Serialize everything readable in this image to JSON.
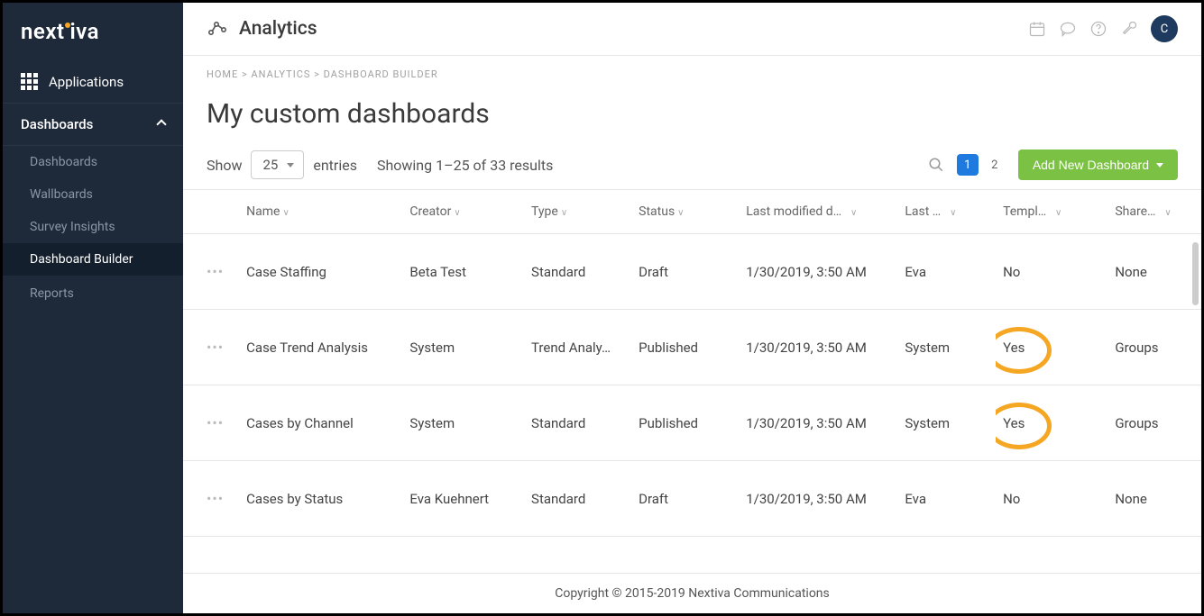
{
  "logo": "nextiva",
  "sidebar": {
    "applications": "Applications",
    "dashboards_header": "Dashboards",
    "items": [
      "Dashboards",
      "Wallboards",
      "Survey Insights",
      "Dashboard Builder"
    ],
    "reports": "Reports"
  },
  "header": {
    "title": "Analytics",
    "avatar_initial": "C"
  },
  "breadcrumb": {
    "home": "HOME",
    "analytics": "ANALYTICS",
    "current": "DASHBOARD BUILDER",
    "sep": " > "
  },
  "page_title": "My custom dashboards",
  "controls": {
    "show_label": "Show",
    "per_page": "25",
    "entries_label": "entries",
    "results_text": "Showing 1–25 of 33 results",
    "pages": [
      "1",
      "2"
    ],
    "add_label": "Add New Dashboard"
  },
  "columns": {
    "name": "Name",
    "creator": "Creator",
    "type": "Type",
    "status": "Status",
    "modified": "Last modified d…",
    "modifier": "Last …",
    "template": "Templ…",
    "shared": "Share…"
  },
  "rows": [
    {
      "name": "Case Staffing",
      "creator": "Beta Test",
      "type": "Standard",
      "status": "Draft",
      "modified": "1/30/2019, 3:50 AM",
      "modifier": "Eva",
      "template": "No",
      "shared": "None",
      "highlight": false
    },
    {
      "name": "Case Trend Analysis",
      "creator": "System",
      "type": "Trend Analy…",
      "status": "Published",
      "modified": "1/30/2019, 3:50 AM",
      "modifier": "System",
      "template": "Yes",
      "shared": "Groups",
      "highlight": true
    },
    {
      "name": "Cases by Channel",
      "creator": "System",
      "type": "Standard",
      "status": "Published",
      "modified": "1/30/2019, 3:50 AM",
      "modifier": "System",
      "template": "Yes",
      "shared": "Groups",
      "highlight": true
    },
    {
      "name": "Cases by Status",
      "creator": "Eva Kuehnert",
      "type": "Standard",
      "status": "Draft",
      "modified": "1/30/2019, 3:50 AM",
      "modifier": "Eva",
      "template": "No",
      "shared": "None",
      "highlight": false
    }
  ],
  "footer": "Copyright © 2015-2019 Nextiva Communications"
}
